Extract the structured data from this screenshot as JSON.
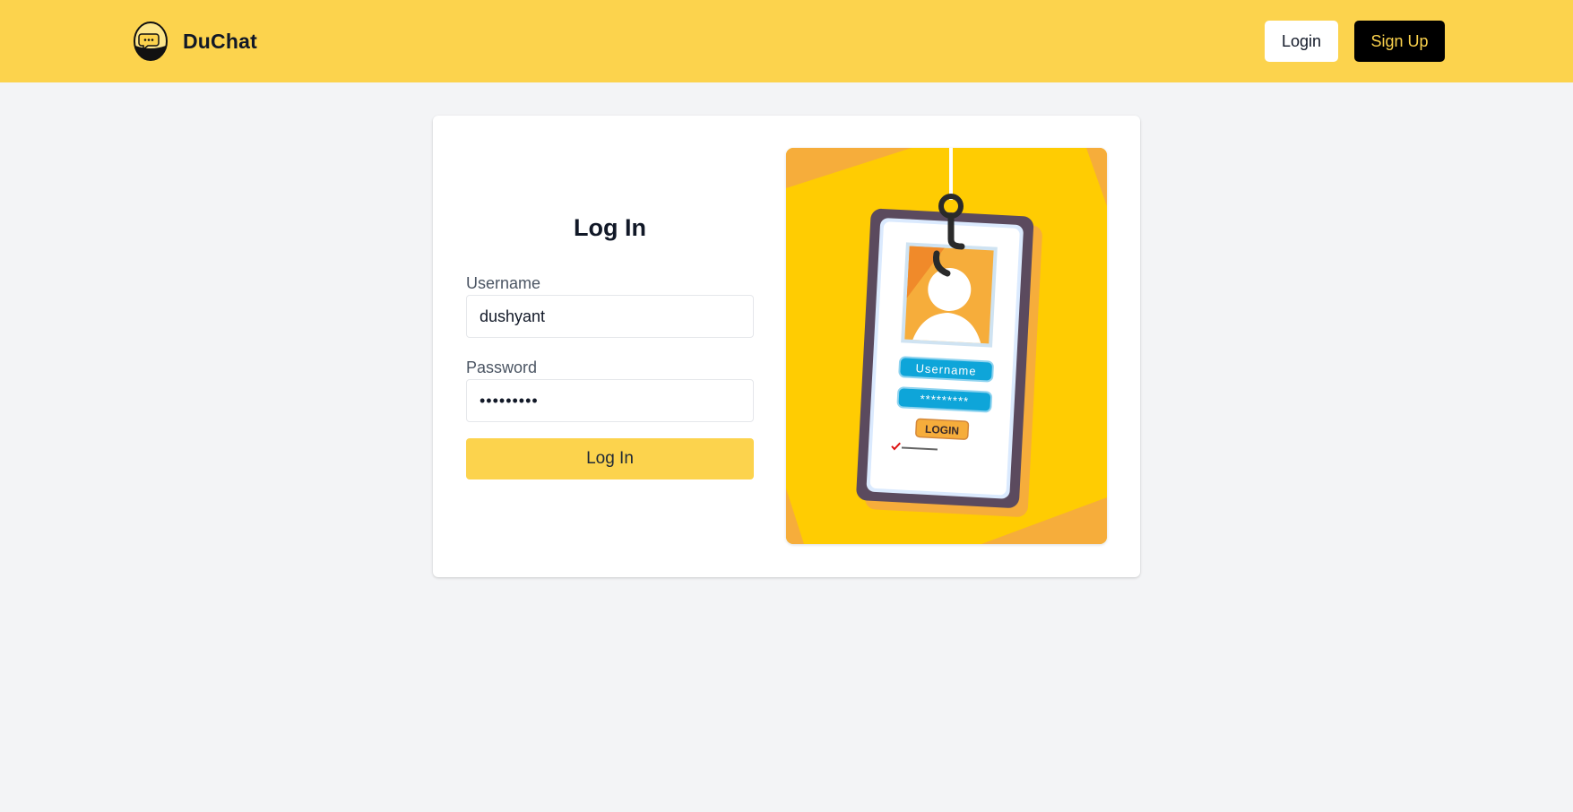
{
  "header": {
    "brand_name": "DuChat",
    "logo_icon": "chat-bubble-logo-icon",
    "login_label": "Login",
    "signup_label": "Sign Up"
  },
  "login_form": {
    "title": "Log In",
    "username_label": "Username",
    "username_value": "dushyant",
    "password_label": "Password",
    "password_value": "password1",
    "submit_label": "Log In"
  },
  "illustration": {
    "username_badge": "Username",
    "password_badge": "*********",
    "login_button": "LOGIN"
  },
  "colors": {
    "header_bg": "#fcd34d",
    "page_bg": "#f3f4f6",
    "accent": "#fcd34d",
    "signup_bg": "#000000",
    "illustration_bg": "#ffcc02"
  }
}
